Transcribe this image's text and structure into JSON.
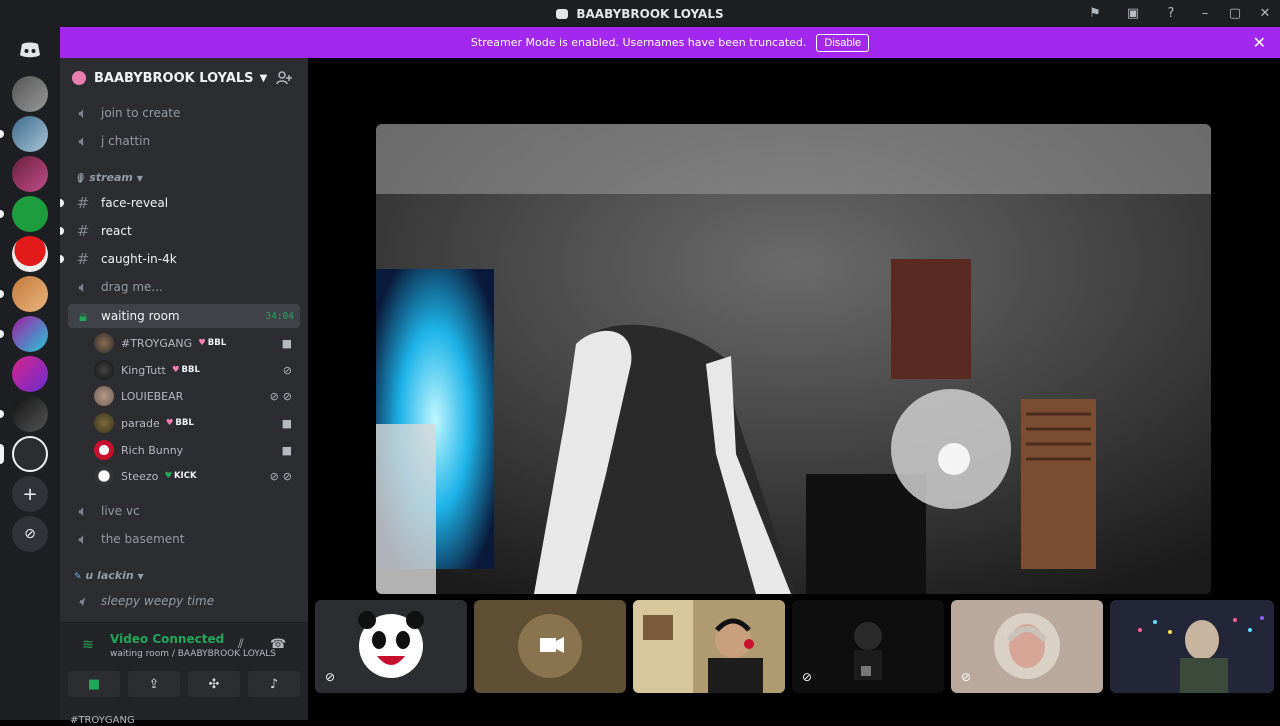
{
  "titlebar": {
    "title": "BAABYBROOK LOYALS"
  },
  "banner": {
    "message": "Streamer Mode is enabled. Usernames have been truncated.",
    "disable_label": "Disable"
  },
  "server": {
    "name": "BAABYBROOK LOYALS"
  },
  "channels": {
    "join_to_create": "join to create",
    "j_chattin": "j chattin",
    "cat_stream": "stream",
    "face_reveal": "face-reveal",
    "react": "react",
    "caught_in_4k": "caught-in-4k",
    "drag_me": "drag me...",
    "waiting_room": "waiting room",
    "waiting_room_time": "34:04",
    "live_vc": "live vc",
    "the_basement": "the basement",
    "cat_u_lackin": "u lackin",
    "sleepy_weepy_time": "sleepy weepy time"
  },
  "voice_users": [
    {
      "name": "#TROYGANG",
      "tag": "BBL"
    },
    {
      "name": "KingTutt",
      "tag": "BBL"
    },
    {
      "name": "LOUIEBEAR",
      "tag": ""
    },
    {
      "name": "parade",
      "tag": "BBL"
    },
    {
      "name": "Rich Bunny",
      "tag": ""
    },
    {
      "name": "Steezo",
      "tag": "KICK"
    }
  ],
  "voice_panel": {
    "status": "Video Connected",
    "location": "waiting room / BAABYBROOK LOYALS",
    "peek": "#TROYGANG"
  },
  "colors": {
    "banner": "#a228f0",
    "sidebar": "#2b2d31",
    "rail": "#1e1f22",
    "connected": "#23a55a"
  }
}
